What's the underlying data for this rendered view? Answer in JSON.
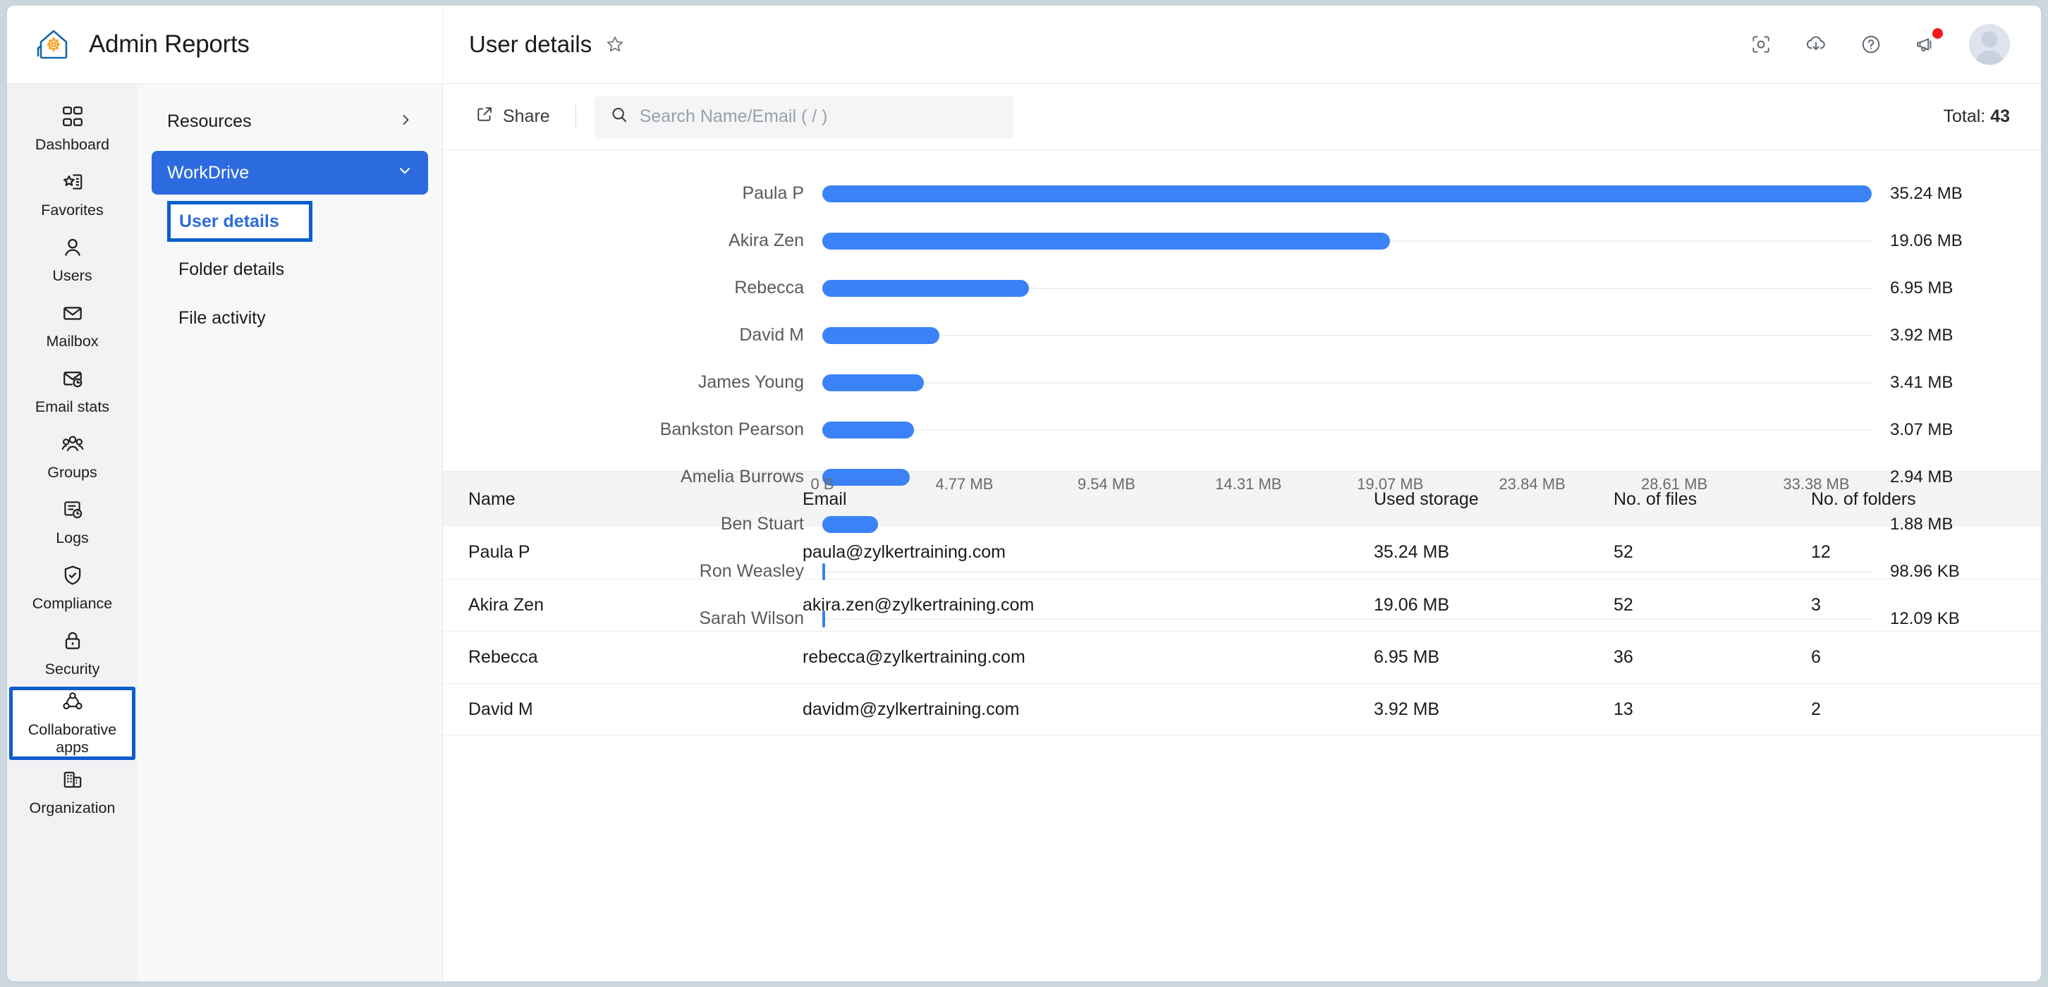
{
  "app": {
    "brand_title": "Admin Reports",
    "logo_icon": "house-gear-icon"
  },
  "header": {
    "page_title": "User details",
    "star_icon": "star-outline-icon",
    "actions": [
      {
        "name": "screenshot-capture-icon",
        "icon": "capture-icon"
      },
      {
        "name": "download-cloud-icon",
        "icon": "cloud-download-icon"
      },
      {
        "name": "help-icon",
        "icon": "question-circle-icon"
      },
      {
        "name": "announcements-icon",
        "icon": "megaphone-icon",
        "badge": true
      }
    ],
    "avatar_icon": "user-avatar"
  },
  "rail": {
    "items": [
      {
        "label": "Dashboard",
        "icon": "grid-squares-icon",
        "selected": false
      },
      {
        "label": "Favorites",
        "icon": "star-document-icon",
        "selected": false
      },
      {
        "label": "Users",
        "icon": "person-icon",
        "selected": false
      },
      {
        "label": "Mailbox",
        "icon": "envelope-icon",
        "selected": false
      },
      {
        "label": "Email stats",
        "icon": "envelope-chart-icon",
        "selected": false
      },
      {
        "label": "Groups",
        "icon": "people-group-icon",
        "selected": false
      },
      {
        "label": "Logs",
        "icon": "document-clock-icon",
        "selected": false
      },
      {
        "label": "Compliance",
        "icon": "shield-check-icon",
        "selected": false
      },
      {
        "label": "Security",
        "icon": "lock-icon",
        "selected": false
      },
      {
        "label": "Collaborative apps",
        "icon": "network-nodes-icon",
        "selected": true
      },
      {
        "label": "Organization",
        "icon": "buildings-icon",
        "selected": false
      }
    ]
  },
  "subnav": {
    "resources_label": "Resources",
    "resources_chevron": "chevron-right-icon",
    "workdrive_label": "WorkDrive",
    "workdrive_chevron": "chevron-down-icon",
    "children": [
      {
        "label": "User details",
        "selected": true
      },
      {
        "label": "Folder details",
        "selected": false
      },
      {
        "label": "File activity",
        "selected": false
      }
    ]
  },
  "toolbar": {
    "share_label": "Share",
    "share_icon": "share-icon",
    "search_icon": "search-icon",
    "search_placeholder": "Search Name/Email ( / )",
    "search_value": "",
    "total_label": "Total:",
    "total_value": "43"
  },
  "chart_data": {
    "type": "bar",
    "orientation": "horizontal",
    "title": "",
    "xlabel": "",
    "ylabel": "",
    "grid": false,
    "legend": "none",
    "bar_color": "#3b82f6",
    "track_color": "#f0f0f0",
    "categories": [
      "Paula P",
      "Akira Zen",
      "Rebecca",
      "David M",
      "James Young",
      "Bankston Pearson",
      "Amelia Burrows",
      "Ben Stuart",
      "Ron Weasley",
      "Sarah Wilson"
    ],
    "values": [
      35.24,
      19.06,
      6.95,
      3.92,
      3.41,
      3.07,
      2.94,
      1.88,
      0.0966,
      0.0118
    ],
    "value_labels": [
      "35.24 MB",
      "19.06 MB",
      "6.95 MB",
      "3.92 MB",
      "3.41 MB",
      "3.07 MB",
      "2.94 MB",
      "1.88 MB",
      "98.96 KB",
      "12.09 KB"
    ],
    "unit": "MB",
    "xlim": [
      0,
      35.24
    ],
    "xticks": [
      0,
      4.77,
      9.54,
      14.31,
      19.07,
      23.84,
      28.61,
      33.38
    ],
    "xticklabels": [
      "0 B",
      "4.77 MB",
      "9.54 MB",
      "14.31 MB",
      "19.07 MB",
      "23.84 MB",
      "28.61 MB",
      "33.38 MB"
    ]
  },
  "table": {
    "columns": [
      "Name",
      "Email",
      "Used storage",
      "No. of files",
      "No. of folders"
    ],
    "rows": [
      {
        "name": "Paula P",
        "email": "paula@zylkertraining.com",
        "storage": "35.24 MB",
        "files": "52",
        "folders": "12"
      },
      {
        "name": "Akira Zen",
        "email": "akira.zen@zylkertraining.com",
        "storage": "19.06 MB",
        "files": "52",
        "folders": "3"
      },
      {
        "name": "Rebecca",
        "email": "rebecca@zylkertraining.com",
        "storage": "6.95 MB",
        "files": "36",
        "folders": "6"
      },
      {
        "name": "David M",
        "email": "davidm@zylkertraining.com",
        "storage": "3.92 MB",
        "files": "13",
        "folders": "2"
      }
    ]
  },
  "colors": {
    "accent_blue": "#2c6bdf",
    "bar_blue": "#3b82f6",
    "focus_outline": "#0d5ecf",
    "rail_bg": "#f0f2f4",
    "subnav_bg": "#f7f8f9",
    "badge_red": "#f51919"
  }
}
